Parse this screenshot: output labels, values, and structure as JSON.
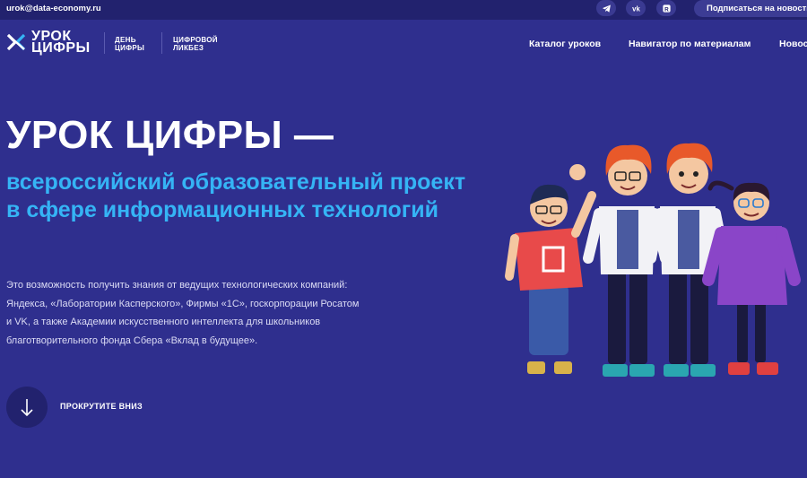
{
  "topbar": {
    "email": "urok@data-economy.ru",
    "social": [
      {
        "name": "telegram-icon"
      },
      {
        "name": "vk-icon"
      },
      {
        "name": "rutube-icon"
      }
    ],
    "subscribe_label": "Подписаться на новости"
  },
  "header": {
    "logo": {
      "line1": "УРОК",
      "line2": "ЦИФРЫ"
    },
    "sub1": {
      "line1": "ДЕНЬ",
      "line2": "ЦИФРЫ"
    },
    "sub2": {
      "line1": "ЦИФРОВОЙ",
      "line2": "ЛИКБЕЗ"
    },
    "nav": [
      "Каталог уроков",
      "Навигатор по материалам",
      "Новости"
    ]
  },
  "hero": {
    "title": "УРОК ЦИФРЫ —",
    "subtitle": "всероссийский образовательный проект в сфере информационных технологий",
    "description": "Это возможность получить знания от ведущих технологических компаний: Яндекса, «Лаборатории Касперского», Фирмы «1С», госкорпорации Росатом и VK, а также Академии искусственного интеллекта для школьников благотворительного фонда Сбера «Вклад в будущее».",
    "scroll_label": "ПРОКРУТИТЕ ВНИЗ"
  },
  "colors": {
    "background": "#2f2f8e",
    "topbar": "#22226e",
    "accent_blue": "#35b4f5",
    "text": "#ffffff"
  }
}
